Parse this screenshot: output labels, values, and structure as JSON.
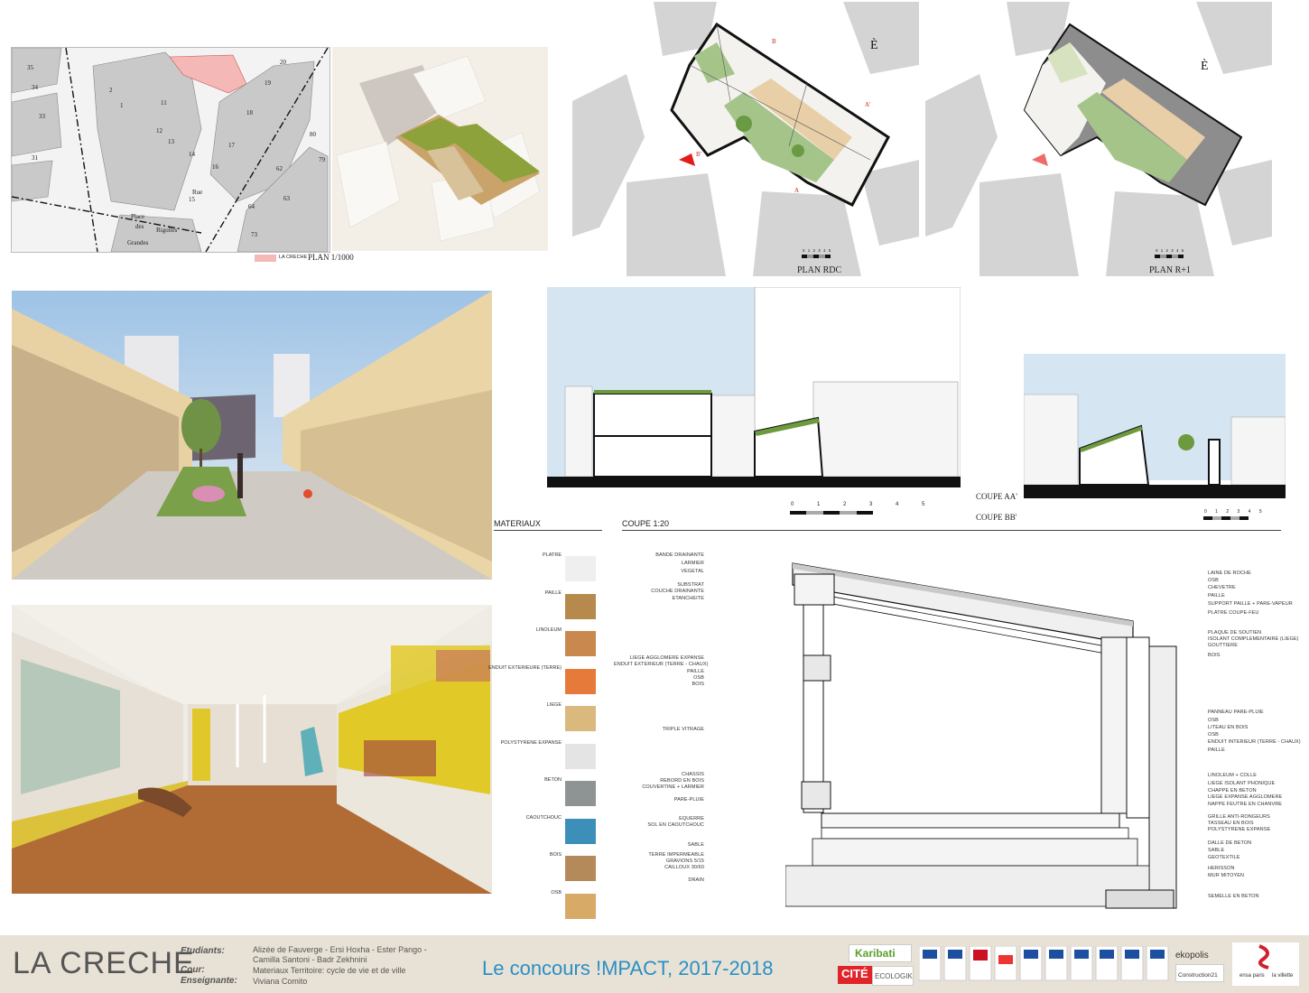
{
  "site_plan": {
    "legend_label": "LA CRECHE",
    "scale_label": "PLAN 1/1000",
    "lot_numbers": [
      "35",
      "34",
      "33",
      "31",
      "20",
      "19",
      "18",
      "17",
      "16",
      "14",
      "13",
      "12",
      "11",
      "15",
      "80",
      "79",
      "62",
      "63",
      "64",
      "73",
      "2",
      "1"
    ],
    "street_labels": [
      "Place",
      "des",
      "Grandes",
      "Rigolles",
      "Rue"
    ],
    "highlight_color": "#f4b9b6"
  },
  "plans": {
    "rdc_label": "PLAN RDC",
    "r1_label": "PLAN R+1",
    "cut_letters": [
      "B",
      "A'",
      "B'",
      "A"
    ],
    "scale_ticks": "0 1 2 3 4 5"
  },
  "sections": {
    "coupe_aa": "COUPE AA'",
    "coupe_bb": "COUPE BB'",
    "scale_ticks": "0 1 2 3 4 5"
  },
  "materials": {
    "title": "MATERIAUX",
    "items": [
      {
        "name": "PLATRE",
        "color": "#efefef"
      },
      {
        "name": "PAILLE",
        "color": "#b58a4c"
      },
      {
        "name": "LINOLEUM",
        "color": "#c9894e"
      },
      {
        "name": "ENDUIT EXTERIEURE (TERRE)",
        "color": "#e67a3a"
      },
      {
        "name": "LIEGE",
        "color": "#d9b97e"
      },
      {
        "name": "POLYSTYRENE EXPANSE",
        "color": "#e4e4e4"
      },
      {
        "name": "BETON",
        "color": "#8e9493"
      },
      {
        "name": "CAOUTCHOUC",
        "color": "#3b8fb8"
      },
      {
        "name": "BOIS",
        "color": "#b58a5a"
      },
      {
        "name": "OSB",
        "color": "#d7aa68"
      }
    ]
  },
  "detail": {
    "title": "COUPE 1:20",
    "left_labels": [
      "BANDE DRAINANTE",
      "LARMIER",
      "VEGETAL",
      "SUBSTRAT",
      "COUCHE DRAINANTE",
      "ETANCHEITE",
      "LIEGE AGGLOMERE EXPANSE",
      "ENDUIT EXTERIEUR (TERRE - CHAUX)",
      "PAILLE",
      "OSB",
      "BOIS",
      "TRIPLE VITRAGE",
      "CHASSIS",
      "REBORD EN BOIS",
      "COUVERTINE + LARMIER",
      "PARE-PLUIE",
      "EQUERRE",
      "SOL EN CAOUTCHOUC",
      "SABLE",
      "TERRE IMPERMEABLE",
      "GRAVIONS 5/15",
      "CAILLOUX 30/60",
      "DRAIN"
    ],
    "right_labels": [
      "LAINE DE ROCHE",
      "OSB",
      "CHEVETRE",
      "PAILLE",
      "SUPPORT PAILLE + PARE-VAPEUR",
      "PLATRE COUPE-FEU",
      "PLAQUE DE SOUTIEN",
      "ISOLANT COMPLEMENTAIRE (LIEGE)",
      "GOUTTIERE",
      "BOIS",
      "PANNEAU PARE-PLUIE",
      "OSB",
      "LITEAU EN BOIS",
      "OSB",
      "ENDUIT INTERIEUR (TERRE - CHAUX)",
      "PAILLE",
      "LINOLEUM + COLLE",
      "LIEGE ISOLANT PHONIQUE",
      "CHAPPE EN BETON",
      "LIEGE EXPANSE AGGLOMERE",
      "NAPPE FEUTRE EN CHANVRE",
      "GRILLE ANTI-RONGEURS",
      "TASSEAU EN BOIS",
      "POLYSTYRENE EXPANSE",
      "DALLE DE BETON",
      "SABLE",
      "GEOTEXTILE",
      "HERISSON",
      "MUR MITOYEN",
      "SEMELLE EN BETON"
    ]
  },
  "footer": {
    "project_title": "LA CRECHE",
    "etudiants_label": "Etudiants:",
    "etudiants_value": "Alizée de Fauverge - Ersi Hoxha - Ester Pango - Camilla Santoni - Badr Zekhnini",
    "cour_label": "Cour:",
    "cour_value": "Materiaux Territoire: cycle de vie et de ville",
    "enseignante_label": "Enseignante:",
    "enseignante_value": "Viviana Comito",
    "contest": "Le concours !MPACT, 2017-2018",
    "contest_color": "#2a8fc4",
    "logo_karibati": "Karibati",
    "logo_cite": "CITÉ",
    "logo_ecologik": "ECOLOGIK",
    "logo_ekopolis": "ekopolis",
    "logo_construction": "Construction21",
    "logo_school_1": "ensa paris",
    "logo_school_2": "la villette"
  }
}
